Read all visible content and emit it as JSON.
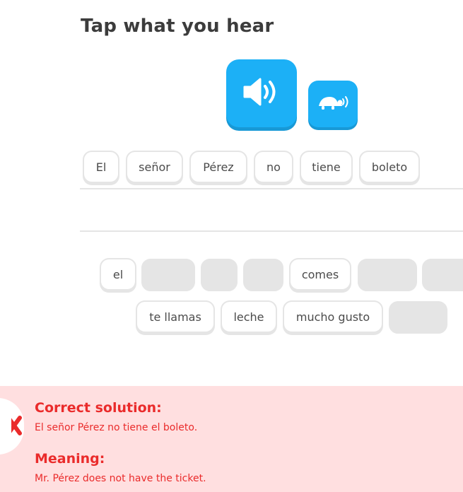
{
  "header": {
    "title": "Tap what you hear"
  },
  "audio": {
    "play_icon": "speaker-icon",
    "slow_icon": "turtle-icon",
    "accent": "#1cb0f6"
  },
  "answer": {
    "words": [
      "El",
      "señor",
      "Pérez",
      "no",
      "tiene",
      "boleto"
    ]
  },
  "bank": {
    "row1": [
      "el",
      "",
      "",
      "",
      "comes",
      "",
      ""
    ],
    "row2": [
      "te llamas",
      "leche",
      "mucho gusto",
      ""
    ]
  },
  "feedback": {
    "status_icon": "close-x-icon",
    "color": "#ea2b2b",
    "background": "#ffdfe0",
    "solution_heading": "Correct solution:",
    "solution_text": "El señor Pérez no tiene el boleto.",
    "meaning_heading": "Meaning:",
    "meaning_text": "Mr. Pérez does not have the ticket."
  }
}
